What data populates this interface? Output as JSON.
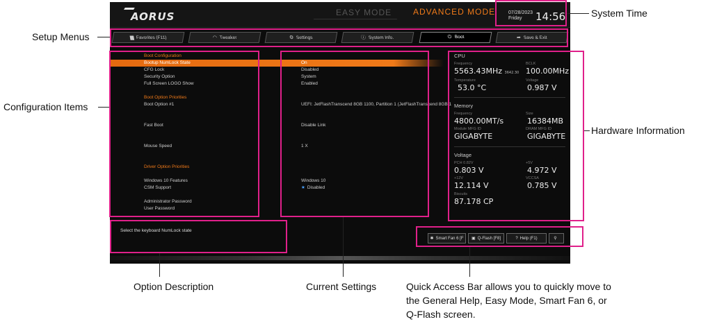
{
  "bios": {
    "logo": "AORUS",
    "mode_easy": "EASY MODE",
    "mode_advanced": "ADVANCED MODE",
    "date": "07/28/2023",
    "day": "Friday",
    "time": "14:56",
    "tabs": [
      {
        "label": "Favorites (F11)",
        "icon": "folder-icon",
        "glyph": "▆"
      },
      {
        "label": "Tweaker",
        "icon": "speedometer-icon",
        "glyph": "◠"
      },
      {
        "label": "Settings",
        "icon": "gear-icon",
        "glyph": "⚙"
      },
      {
        "label": "System Info.",
        "icon": "info-icon",
        "glyph": "ⓘ"
      },
      {
        "label": "Boot",
        "icon": "power-icon",
        "glyph": "⏻"
      },
      {
        "label": "Save & Exit",
        "icon": "exit-icon",
        "glyph": "➦"
      }
    ],
    "active_tab": "Boot",
    "items": [
      {
        "label": "Boot Configuration",
        "value": "",
        "type": "header"
      },
      {
        "label": "Bootup NumLock State",
        "value": "On",
        "type": "selected"
      },
      {
        "label": "CFG Lock",
        "value": "Disabled"
      },
      {
        "label": "Security Option",
        "value": "System"
      },
      {
        "label": "Full Screen LOGO Show",
        "value": "Enabled"
      },
      {
        "label": "Boot Option Priorities",
        "value": "",
        "type": "header"
      },
      {
        "label": "Boot Option #1",
        "value": "UEFI: JetFlashTranscend 8GB 1100, Partition 1 (JetFlashTranscend 8GB 1"
      },
      {
        "label": "Fast Boot",
        "value": "Disable Link"
      },
      {
        "label": "Mouse Speed",
        "value": "1 X"
      },
      {
        "label": "Driver Option Priorities",
        "value": "",
        "type": "header"
      },
      {
        "label": "Windows 10 Features",
        "value": "Windows 10"
      },
      {
        "label": "CSM Support",
        "value": "Disabled",
        "starred": true
      },
      {
        "label": "Administrator Password",
        "value": ""
      },
      {
        "label": "User Password",
        "value": ""
      }
    ],
    "description": "Select the keyboard NumLock state",
    "hardware": {
      "cpu_title": "CPU",
      "freq_label": "Frequency",
      "freq_value": "5563.43MHz",
      "freq_sub": "3642.30",
      "bclk_label": "BCLK",
      "bclk_value": "100.00MHz",
      "temp_label": "Temperature",
      "temp_value": "53.0 °C",
      "voltage_label": "Voltage",
      "voltage_value": "0.987 V",
      "mem_title": "Memory",
      "mem_freq_label": "Frequency",
      "mem_freq_value": "4800.00MT/s",
      "mem_size_label": "Size",
      "mem_size_value": "16384MB",
      "module_label": "Module MFG ID",
      "module_value": "GIGABYTE",
      "dram_label": "DRAM MFG ID",
      "dram_value": "GIGABYTE",
      "volt_title": "Voltage",
      "pch_label": "PCH 0.82V",
      "pch_value": "0.803 V",
      "p5v_label": "+5V",
      "p5v_value": "4.972 V",
      "p12v_label": "+12V",
      "p12v_value": "12.114 V",
      "vccsa_label": "VCCSA",
      "vccsa_value": "0.785 V",
      "biscuits_label": "Biscuits",
      "biscuits_value": "87.178 CP"
    },
    "quick_access": [
      {
        "label": "Smart Fan 6 [F",
        "icon": "fan-icon",
        "glyph": "✱"
      },
      {
        "label": "Q-Flash [F8]",
        "icon": "flash-icon",
        "glyph": "▣"
      },
      {
        "label": "Help (F1)",
        "icon": "help-icon",
        "glyph": "?"
      },
      {
        "label": "",
        "icon": "search-icon",
        "glyph": "⚲"
      }
    ]
  },
  "annotations": {
    "system_time": "System Time",
    "setup_menus": "Setup Menus",
    "configuration_items": "Configuration Items",
    "hardware_information": "Hardware Information",
    "option_description": "Option Description",
    "current_settings": "Current Settings",
    "quick_access_line1": "Quick Access Bar allows you to quickly move to",
    "quick_access_line2": "the General Help, Easy Mode, Smart Fan 6, or",
    "quick_access_line3": "Q-Flash screen."
  },
  "colors": {
    "accent_orange": "#f07a19",
    "highlight_magenta": "#e0208a",
    "background": "#0c0c0c"
  }
}
